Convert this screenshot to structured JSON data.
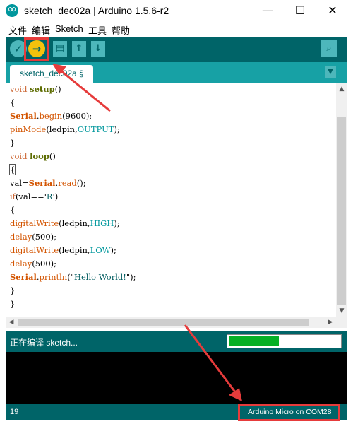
{
  "window": {
    "title": "sketch_dec02a | Arduino 1.5.6-r2",
    "minimize": "—",
    "maximize": "☐",
    "close": "✕"
  },
  "menu": [
    "文件",
    "编辑",
    "Sketch",
    "工具",
    "帮助"
  ],
  "toolbar": {
    "verify_glyph": "✓",
    "upload_glyph": "→",
    "new_glyph": "▤",
    "open_glyph": "↑",
    "save_glyph": "↓",
    "serial_glyph": "⌕"
  },
  "tab": {
    "label": "sketch_dec02a §",
    "menu_glyph": "▼"
  },
  "code": [
    [
      {
        "t": "void ",
        "c": "type"
      },
      {
        "t": "setup",
        "c": "fn"
      },
      {
        "t": "()",
        "c": ""
      }
    ],
    [
      {
        "t": "{",
        "c": ""
      }
    ],
    [
      {
        "t": "Serial",
        "c": "serial"
      },
      {
        "t": ".",
        "c": ""
      },
      {
        "t": "begin",
        "c": "orange"
      },
      {
        "t": "(9600);",
        "c": ""
      }
    ],
    [
      {
        "t": "pinMode",
        "c": "orange"
      },
      {
        "t": "(ledpin,",
        "c": ""
      },
      {
        "t": "OUTPUT",
        "c": "const"
      },
      {
        "t": ");",
        "c": ""
      }
    ],
    [
      {
        "t": "}",
        "c": ""
      }
    ],
    [
      {
        "t": "void ",
        "c": "type"
      },
      {
        "t": "loop",
        "c": "fn"
      },
      {
        "t": "()",
        "c": ""
      }
    ],
    [
      {
        "t": "{",
        "c": "cursor"
      }
    ],
    [
      {
        "t": "val=",
        "c": ""
      },
      {
        "t": "Serial",
        "c": "serial"
      },
      {
        "t": ".",
        "c": ""
      },
      {
        "t": "read",
        "c": "orange"
      },
      {
        "t": "();",
        "c": ""
      }
    ],
    [
      {
        "t": "if",
        "c": "type"
      },
      {
        "t": "(val=='",
        "c": ""
      },
      {
        "t": "R",
        "c": "str"
      },
      {
        "t": "')",
        "c": ""
      }
    ],
    [
      {
        "t": "{",
        "c": ""
      }
    ],
    [
      {
        "t": "digitalWrite",
        "c": "orange"
      },
      {
        "t": "(ledpin,",
        "c": ""
      },
      {
        "t": "HIGH",
        "c": "const"
      },
      {
        "t": ");",
        "c": ""
      }
    ],
    [
      {
        "t": "delay",
        "c": "orange"
      },
      {
        "t": "(500);",
        "c": ""
      }
    ],
    [
      {
        "t": "digitalWrite",
        "c": "orange"
      },
      {
        "t": "(ledpin,",
        "c": ""
      },
      {
        "t": "LOW",
        "c": "const"
      },
      {
        "t": ");",
        "c": ""
      }
    ],
    [
      {
        "t": "delay",
        "c": "orange"
      },
      {
        "t": "(500);",
        "c": ""
      }
    ],
    [
      {
        "t": "Serial",
        "c": "serial"
      },
      {
        "t": ".",
        "c": ""
      },
      {
        "t": "println",
        "c": "orange"
      },
      {
        "t": "(\"",
        "c": ""
      },
      {
        "t": "Hello World!",
        "c": "str"
      },
      {
        "t": "\");",
        "c": ""
      }
    ],
    [
      {
        "t": "}",
        "c": ""
      }
    ],
    [
      {
        "t": "}",
        "c": ""
      }
    ]
  ],
  "status": {
    "message": "正在编译 sketch...",
    "progress": 0.45
  },
  "bottom": {
    "line_number": "19",
    "board": "Arduino Micro on COM28"
  },
  "scroll": {
    "up": "▲",
    "down": "▼",
    "left": "◀",
    "right": "▶"
  },
  "colors": {
    "toolbar_bg": "#006468",
    "tab_strip_bg": "#17a1a5",
    "button_bg": "#4db7bb",
    "upload_active": "#f4c20d",
    "annotation_red": "#e63b3b",
    "progress_fill": "#06b025"
  }
}
